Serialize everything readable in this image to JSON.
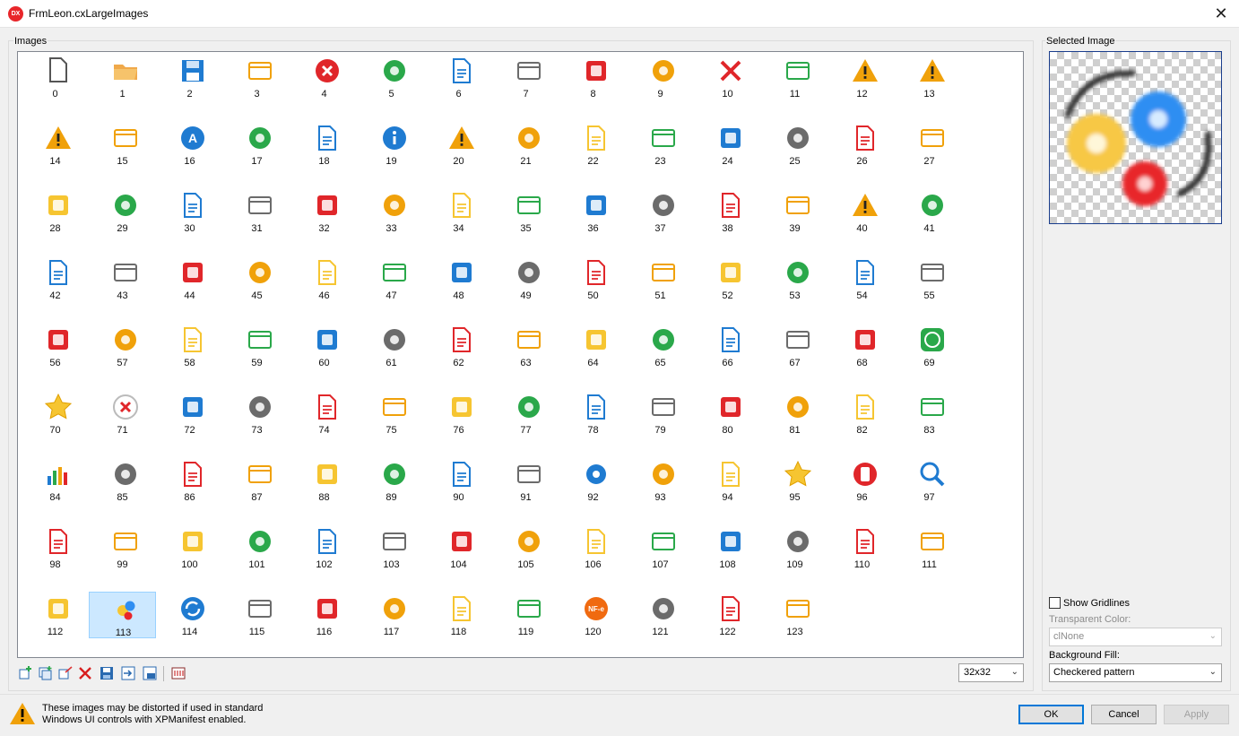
{
  "window": {
    "title": "FrmLeon.cxLargeImages",
    "app_icon_text": "DX"
  },
  "images_group": {
    "label": "Images"
  },
  "selected_group": {
    "label": "Selected Image"
  },
  "image_indices": [
    "0",
    "1",
    "2",
    "3",
    "4",
    "5",
    "6",
    "7",
    "8",
    "9",
    "10",
    "11",
    "12",
    "13",
    "14",
    "15",
    "16",
    "17",
    "18",
    "19",
    "20",
    "21",
    "22",
    "23",
    "24",
    "25",
    "26",
    "27",
    "28",
    "29",
    "30",
    "31",
    "32",
    "33",
    "34",
    "35",
    "36",
    "37",
    "38",
    "39",
    "40",
    "41",
    "42",
    "43",
    "44",
    "45",
    "46",
    "47",
    "48",
    "49",
    "50",
    "51",
    "52",
    "53",
    "54",
    "55",
    "56",
    "57",
    "58",
    "59",
    "60",
    "61",
    "62",
    "63",
    "64",
    "65",
    "66",
    "67",
    "68",
    "69",
    "70",
    "71",
    "72",
    "73",
    "74",
    "75",
    "76",
    "77",
    "78",
    "79",
    "80",
    "81",
    "82",
    "83",
    "84",
    "85",
    "86",
    "87",
    "88",
    "89",
    "90",
    "91",
    "92",
    "93",
    "94",
    "95",
    "96",
    "97",
    "98",
    "99",
    "100",
    "101",
    "102",
    "103",
    "104",
    "105",
    "106",
    "107",
    "108",
    "109",
    "110",
    "111",
    "112",
    "113",
    "114",
    "115",
    "116",
    "117",
    "118",
    "119",
    "120",
    "121",
    "122",
    "123"
  ],
  "selected_index": 113,
  "icon_colors": {
    "blue": "#1f7bd1",
    "gray": "#6b6b6b",
    "red": "#e0262a",
    "orange": "#f0a10a",
    "yellow": "#f6c531",
    "green": "#2aa84a"
  },
  "toolbar": {
    "buttons": [
      "add-icon",
      "add-from-file-icon",
      "replace-icon",
      "delete-icon",
      "save-icon",
      "export-icon",
      "resize-32-icon",
      "convert-icon"
    ]
  },
  "size_select": {
    "value": "32x32"
  },
  "options": {
    "show_gridlines_label": "Show Gridlines",
    "show_gridlines_checked": false,
    "transparent_color_label": "Transparent Color:",
    "transparent_color_value": "clNone",
    "background_fill_label": "Background Fill:",
    "background_fill_value": "Checkered pattern"
  },
  "warning": {
    "line1": "These images may be distorted if used in standard",
    "line2": "Windows UI controls with XPManifest enabled."
  },
  "buttons": {
    "ok": "OK",
    "cancel": "Cancel",
    "apply": "Apply"
  }
}
